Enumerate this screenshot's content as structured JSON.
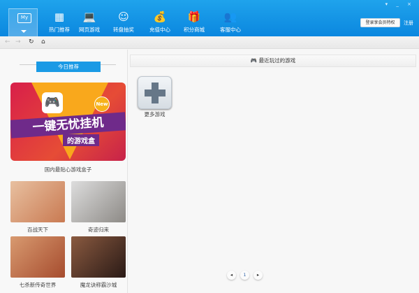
{
  "header": {
    "my_label": "My",
    "nav": [
      {
        "label": "热门推荐",
        "icon": "grid-icon",
        "glyph": "▦"
      },
      {
        "label": "网页游戏",
        "icon": "laptop-icon",
        "glyph": "💻"
      },
      {
        "label": "转盘抽奖",
        "icon": "wheel-icon",
        "glyph": "☺"
      },
      {
        "label": "充值中心",
        "icon": "money-bag-icon",
        "glyph": "💰"
      },
      {
        "label": "积分商城",
        "icon": "gift-icon",
        "glyph": "🎁"
      },
      {
        "label": "客服中心",
        "icon": "support-icon",
        "glyph": "👥"
      }
    ],
    "window_controls": "▾ _ ×",
    "login_button": "登录享会员特权",
    "register": "注册"
  },
  "toolbar": {
    "back": "←",
    "forward": "→",
    "refresh": "↻",
    "home": "⌂"
  },
  "left": {
    "ribbon": "今日推荐",
    "banner": {
      "title": "一键无忧挂机",
      "subtitle": "的游戏盒",
      "badge": "New",
      "caption": "国内最贴心游戏盒子"
    },
    "games": [
      {
        "name": "百战天下",
        "color": "#c97a52"
      },
      {
        "name": "奇迹归来",
        "color": "#8d8a86"
      },
      {
        "name": "七杀新传奇世界",
        "color": "#a64c2e"
      },
      {
        "name": "魔龙诀称霸沙城",
        "color": "#4a2a22"
      }
    ]
  },
  "main": {
    "title": "最近玩过的游戏",
    "more_games": "更多游戏",
    "pagination": {
      "prev": "◂",
      "page": "1",
      "next": "▸"
    }
  }
}
